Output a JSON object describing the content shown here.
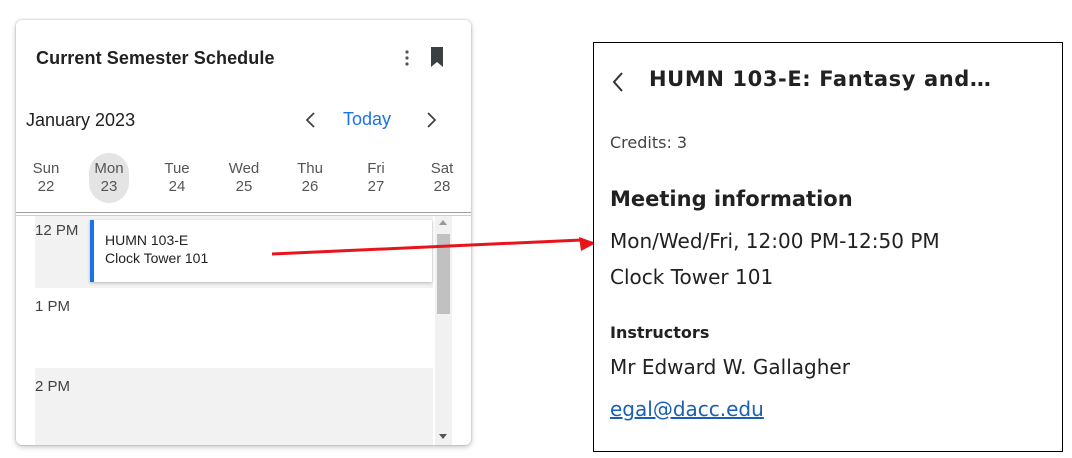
{
  "schedule": {
    "title": "Current Semester Schedule",
    "month": "January 2023",
    "today_label": "Today",
    "days": [
      {
        "name": "Sun",
        "num": "22"
      },
      {
        "name": "Mon",
        "num": "23"
      },
      {
        "name": "Tue",
        "num": "24"
      },
      {
        "name": "Wed",
        "num": "25"
      },
      {
        "name": "Thu",
        "num": "26"
      },
      {
        "name": "Fri",
        "num": "27"
      },
      {
        "name": "Sat",
        "num": "28"
      }
    ],
    "hours": [
      "12 PM",
      "1 PM",
      "2 PM"
    ],
    "event": {
      "course": "HUMN 103-E",
      "location": "Clock Tower 101"
    }
  },
  "detail": {
    "title": "HUMN 103-E: Fantasy and…",
    "credits": "Credits: 3",
    "meeting_heading": "Meeting information",
    "meeting_time": "Mon/Wed/Fri, 12:00 PM-12:50 PM",
    "meeting_location": "Clock Tower 101",
    "instructors_heading": "Instructors",
    "instructor_name": "Mr Edward W. Gallagher",
    "instructor_email": "egal@dacc.edu"
  },
  "colors": {
    "accent": "#1a73e8",
    "arrow": "#e8141b",
    "link": "#1a5fb4"
  },
  "icons": [
    "more-vert-icon",
    "bookmark-icon",
    "chevron-left-icon",
    "chevron-right-icon",
    "back-chevron-icon"
  ]
}
